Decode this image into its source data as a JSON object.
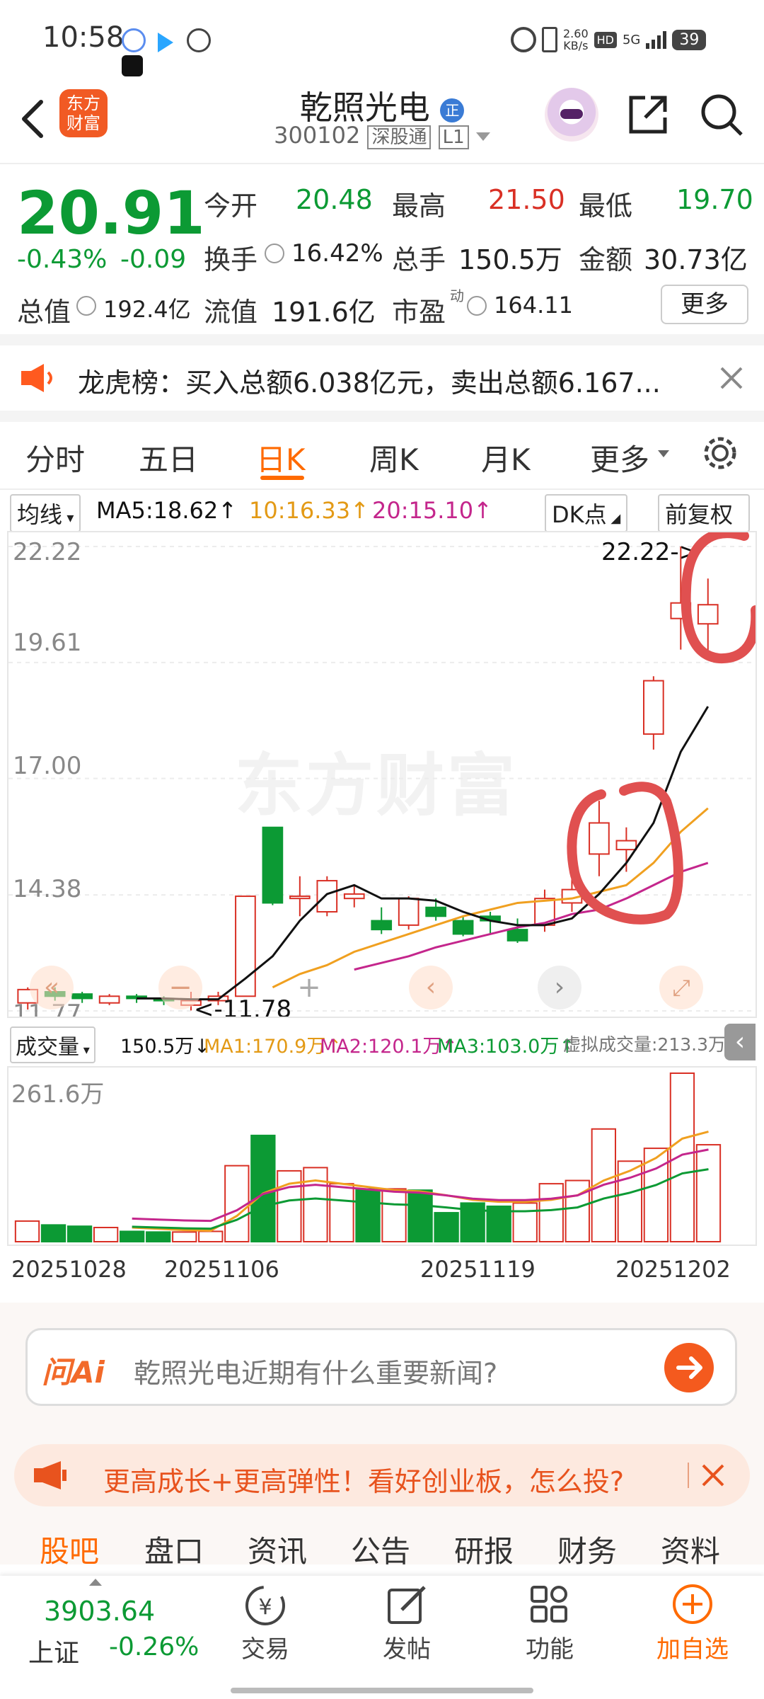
{
  "status_bar": {
    "time": "10:58",
    "net_speed_value": "2.60",
    "net_speed_unit": "KB/s",
    "hd": "HD",
    "network": "5G",
    "battery": "39"
  },
  "header": {
    "back_icon": "chevron-left-icon",
    "logo_text_1": "东方",
    "logo_text_2": "财富",
    "stock_name": "乾照光电",
    "name_badge": "正",
    "stock_code": "300102",
    "market_tag": "深股通",
    "level_tag": "L1"
  },
  "quote": {
    "price": "20.91",
    "change_pct": "-0.43%",
    "change_abs": "-0.09",
    "open_label": "今开",
    "open": "20.48",
    "high_label": "最高",
    "high": "21.50",
    "low_label": "最低",
    "low": "19.70",
    "turnover_label": "换手",
    "turnover": "16.42%",
    "volume_label": "总手",
    "volume": "150.5万",
    "amount_label": "金额",
    "amount": "30.73亿",
    "mktcap_label": "总值",
    "mktcap": "192.4亿",
    "float_label": "流值",
    "float": "191.6亿",
    "pe_label": "市盈",
    "pe_sup": "动",
    "pe": "164.11",
    "more_label": "更多"
  },
  "notice": {
    "text": "龙虎榜：买入总额6.038亿元，卖出总额6.167..."
  },
  "period_tabs": [
    "分时",
    "五日",
    "日K",
    "周K",
    "月K",
    "更多"
  ],
  "active_tab": "日K",
  "chart_toolbar": {
    "indicator": "均线",
    "ma5": "MA5:18.62",
    "ma10": "10:16.33",
    "ma20": "20:15.10",
    "dk": "DK点",
    "fq": "前复权"
  },
  "price_axis": [
    "22.22",
    "19.61",
    "17.00",
    "14.38",
    "11.77"
  ],
  "annot_high": "22.22->",
  "annot_low": "<-11.78",
  "watermark": "东方财富",
  "volume_toolbar": {
    "indicator": "成交量",
    "vol": "150.5万",
    "ma1": "MA1:170.9万",
    "ma2": "MA2:120.1万",
    "ma3": "MA3:103.0万",
    "virtual": "虚拟成交量:213.3万"
  },
  "volume_axis_max": "261.6万",
  "dates": [
    "20251028",
    "20251106",
    "20251119",
    "20251202"
  ],
  "ai_bar": {
    "logo": "问Ai",
    "placeholder": "乾照光电近期有什么重要新闻?"
  },
  "promo": {
    "text": "更高成长+更高弹性！看好创业板，怎么投?"
  },
  "bottom_tabs": [
    "股吧",
    "盘口",
    "资讯",
    "公告",
    "研报",
    "财务",
    "资料"
  ],
  "bottom_nav": {
    "index_value": "3903.64",
    "index_name": "上证",
    "index_change": "-0.26%",
    "trade": "交易",
    "post": "发帖",
    "func": "功能",
    "add": "加自选"
  },
  "colors": {
    "up": "#d93025",
    "down": "#0c9a34",
    "accent": "#ff6a00",
    "ma5": "#111111",
    "ma10": "#f0a020",
    "ma20": "#c4268c"
  },
  "chart_data": {
    "type": "candlestick",
    "y_range": [
      11.77,
      22.22
    ],
    "candles": [
      {
        "o": 11.95,
        "c": 12.25,
        "h": 12.3,
        "l": 11.8
      },
      {
        "o": 12.2,
        "c": 12.1,
        "h": 12.3,
        "l": 12.0
      },
      {
        "o": 12.15,
        "c": 12.05,
        "h": 12.2,
        "l": 11.95
      },
      {
        "o": 11.95,
        "c": 12.1,
        "h": 12.15,
        "l": 11.9
      },
      {
        "o": 12.1,
        "c": 12.05,
        "h": 12.15,
        "l": 11.95
      },
      {
        "o": 12.05,
        "c": 12.0,
        "h": 12.1,
        "l": 11.9
      },
      {
        "o": 11.9,
        "c": 12.0,
        "h": 12.2,
        "l": 11.78
      },
      {
        "o": 12.0,
        "c": 12.1,
        "h": 12.2,
        "l": 11.9
      },
      {
        "o": 12.1,
        "c": 14.35,
        "h": 14.35,
        "l": 12.1
      },
      {
        "o": 15.9,
        "c": 14.2,
        "h": 15.9,
        "l": 14.15
      },
      {
        "o": 14.3,
        "c": 14.35,
        "h": 14.8,
        "l": 13.9
      },
      {
        "o": 14.0,
        "c": 14.7,
        "h": 14.8,
        "l": 13.9
      },
      {
        "o": 14.3,
        "c": 14.4,
        "h": 14.6,
        "l": 14.1
      },
      {
        "o": 13.8,
        "c": 13.6,
        "h": 14.1,
        "l": 13.5
      },
      {
        "o": 13.7,
        "c": 14.3,
        "h": 14.35,
        "l": 13.6
      },
      {
        "o": 14.1,
        "c": 13.9,
        "h": 14.3,
        "l": 13.8
      },
      {
        "o": 13.8,
        "c": 13.5,
        "h": 13.9,
        "l": 13.45
      },
      {
        "o": 13.9,
        "c": 13.8,
        "h": 14.0,
        "l": 13.5
      },
      {
        "o": 13.6,
        "c": 13.35,
        "h": 13.85,
        "l": 13.3
      },
      {
        "o": 13.7,
        "c": 14.3,
        "h": 14.5,
        "l": 13.55
      },
      {
        "o": 14.2,
        "c": 14.5,
        "h": 14.8,
        "l": 14.0
      },
      {
        "o": 15.3,
        "c": 16.0,
        "h": 16.5,
        "l": 14.8
      },
      {
        "o": 15.4,
        "c": 15.6,
        "h": 15.9,
        "l": 14.9
      },
      {
        "o": 18.0,
        "c": 19.2,
        "h": 19.3,
        "l": 17.65
      },
      {
        "o": 20.6,
        "c": 20.95,
        "h": 22.22,
        "l": 19.9
      },
      {
        "o": 20.48,
        "c": 20.91,
        "h": 21.5,
        "l": 19.7
      }
    ],
    "ma5": [
      null,
      null,
      null,
      null,
      12.05,
      12.05,
      12.03,
      12.03,
      12.5,
      13.0,
      13.8,
      14.4,
      14.6,
      14.3,
      14.3,
      14.25,
      14.0,
      13.8,
      13.7,
      13.7,
      13.85,
      14.4,
      15.1,
      16.0,
      17.6,
      18.62
    ],
    "ma10": [
      null,
      null,
      null,
      null,
      null,
      null,
      null,
      null,
      null,
      12.3,
      12.6,
      12.8,
      13.1,
      13.3,
      13.5,
      13.7,
      13.9,
      14.05,
      14.2,
      14.25,
      14.3,
      14.45,
      14.6,
      15.1,
      15.8,
      16.33
    ],
    "ma20": [
      null,
      null,
      null,
      null,
      null,
      null,
      null,
      null,
      null,
      null,
      null,
      null,
      12.7,
      12.85,
      13.0,
      13.2,
      13.35,
      13.5,
      13.65,
      13.75,
      13.95,
      14.05,
      14.3,
      14.6,
      14.9,
      15.1
    ],
    "volume_range": [
      0,
      261.6
    ],
    "volumes": [
      32,
      26,
      24,
      22,
      16,
      15,
      15,
      16,
      118,
      165,
      110,
      115,
      90,
      82,
      82,
      80,
      45,
      60,
      55,
      60,
      90,
      95,
      175,
      125,
      145,
      261.6,
      150.5
    ],
    "volume_ma": [
      null,
      null,
      null,
      null,
      22,
      20,
      18,
      17,
      40,
      75,
      90,
      95,
      90,
      85,
      80,
      78,
      72,
      65,
      62,
      62,
      65,
      72,
      95,
      110,
      130,
      160,
      170.9
    ]
  }
}
